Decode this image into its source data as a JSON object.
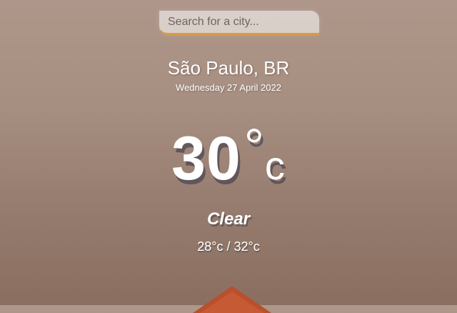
{
  "search": {
    "placeholder": "Search for a city...",
    "value": ""
  },
  "location": {
    "city": "São Paulo, BR",
    "date": "Wednesday 27 April 2022"
  },
  "current": {
    "temperature": "30",
    "degree_symbol": "°",
    "unit": "c",
    "condition": "Clear",
    "range": "28°c / 32°c"
  },
  "colors": {
    "background_top": "#ae978a",
    "background_bottom": "#8a6f61",
    "search_underline": "#dc9a45",
    "text": "#ffffff",
    "roof": "#b8502e"
  }
}
